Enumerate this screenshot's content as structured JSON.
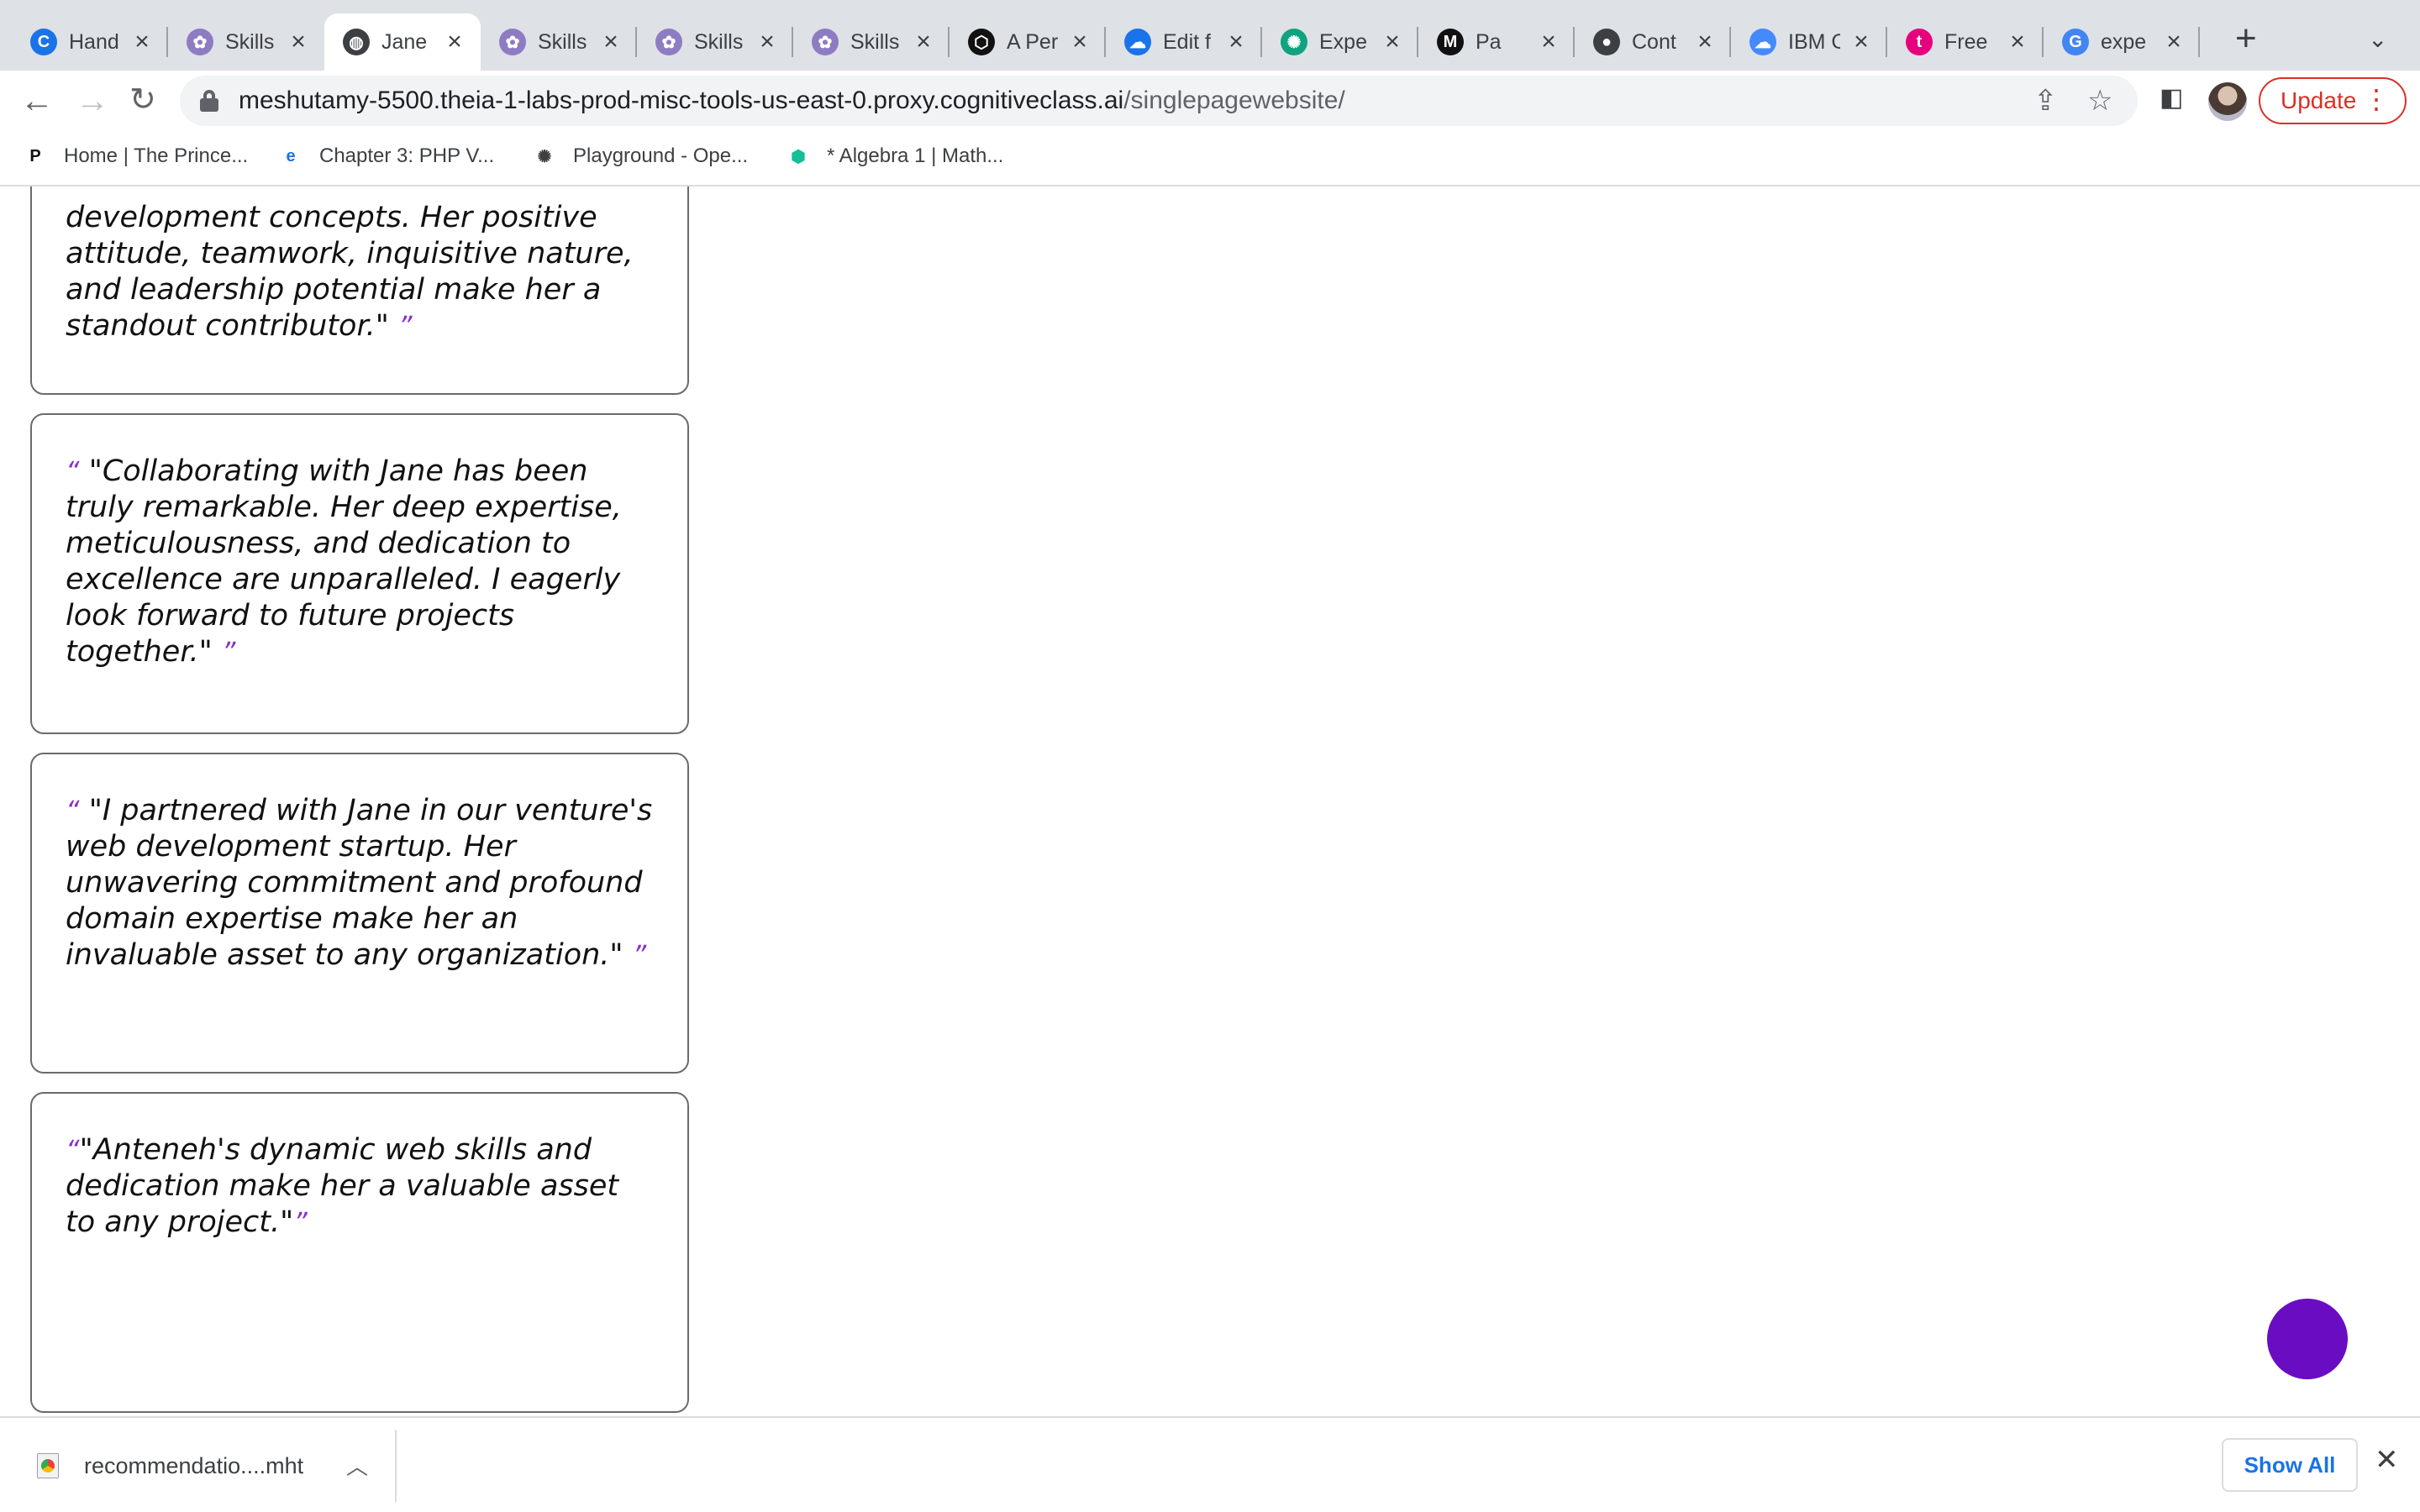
{
  "browser": {
    "tabs": [
      {
        "title": "Hand",
        "favicon": "c-logo-icon",
        "color": "#1a73e8",
        "glyph": "C"
      },
      {
        "title": "Skills",
        "favicon": "skills-network-icon",
        "color": "#8e7cc3",
        "glyph": "✿"
      },
      {
        "title": "Jane",
        "favicon": "globe-icon",
        "color": "#3c4043",
        "glyph": "◍",
        "active": true
      },
      {
        "title": "Skills",
        "favicon": "skills-network-icon",
        "color": "#8e7cc3",
        "glyph": "✿"
      },
      {
        "title": "Skills",
        "favicon": "skills-network-icon",
        "color": "#8e7cc3",
        "glyph": "✿"
      },
      {
        "title": "Skills",
        "favicon": "skills-network-icon",
        "color": "#8e7cc3",
        "glyph": "✿"
      },
      {
        "title": "A Per",
        "favicon": "codepen-icon",
        "color": "#111111",
        "glyph": "⬡"
      },
      {
        "title": "Edit f",
        "favicon": "cloud-icon",
        "color": "#1a73e8",
        "glyph": "☁"
      },
      {
        "title": "Expe",
        "favicon": "openai-icon",
        "color": "#10a37f",
        "glyph": "✺"
      },
      {
        "title": "Pa",
        "favicon": "medium-icon",
        "color": "#111111",
        "glyph": "M"
      },
      {
        "title": "Cont",
        "favicon": "github-icon",
        "color": "#3c4043",
        "glyph": "●"
      },
      {
        "title": "IBM C",
        "favicon": "ibm-cloud-icon",
        "color": "#4589ff",
        "glyph": "☁"
      },
      {
        "title": "Free",
        "favicon": "tutor-icon",
        "color": "#e6007e",
        "glyph": "t"
      },
      {
        "title": "expe",
        "favicon": "google-icon",
        "color": "#4285f4",
        "glyph": "G"
      }
    ],
    "url_host": "meshutamy-5500.theia-1-labs-prod-misc-tools-us-east-0.proxy.cognitiveclass.ai",
    "url_path": "/singlepagewebsite/",
    "update_label": "Update",
    "bookmarks": [
      {
        "label": "Home | The Prince...",
        "icon": "princeton-review-icon",
        "glyph": "P",
        "color": "#111111"
      },
      {
        "label": "Chapter 3: PHP V...",
        "icon": "edge-like-icon",
        "glyph": "e",
        "color": "#1a73e8"
      },
      {
        "label": "Playground - Ope...",
        "icon": "openai-icon",
        "glyph": "✺",
        "color": "#3c4043"
      },
      {
        "label": "* Algebra 1 | Math...",
        "icon": "khan-academy-icon",
        "glyph": "⬢",
        "color": "#14bf96"
      }
    ]
  },
  "testimonials": [
    {
      "text": "development concepts. Her positive attitude, teamwork, inquisitive nature, and leadership potential make her a standout contributor.\"",
      "open_quote": "",
      "close_quote": "”"
    },
    {
      "text": "\"Collaborating with Jane has been truly remarkable. Her deep expertise, meticulousness, and dedication to excellence are unparalleled. I eagerly look forward to future projects together.\"",
      "open_quote": "“",
      "close_quote": "”"
    },
    {
      "text": "\"I partnered with Jane in our venture's web development startup. Her unwavering commitment and profound domain expertise make her an invaluable asset to any organization.\"",
      "open_quote": "“",
      "close_quote": "”"
    },
    {
      "text": "\"Anteneh's dynamic web skills and dedication make her a valuable asset to any project.\"",
      "open_quote": "“",
      "close_quote": "”"
    }
  ],
  "downloads": {
    "file_name": "recommendatio....mht",
    "show_all_label": "Show All"
  }
}
